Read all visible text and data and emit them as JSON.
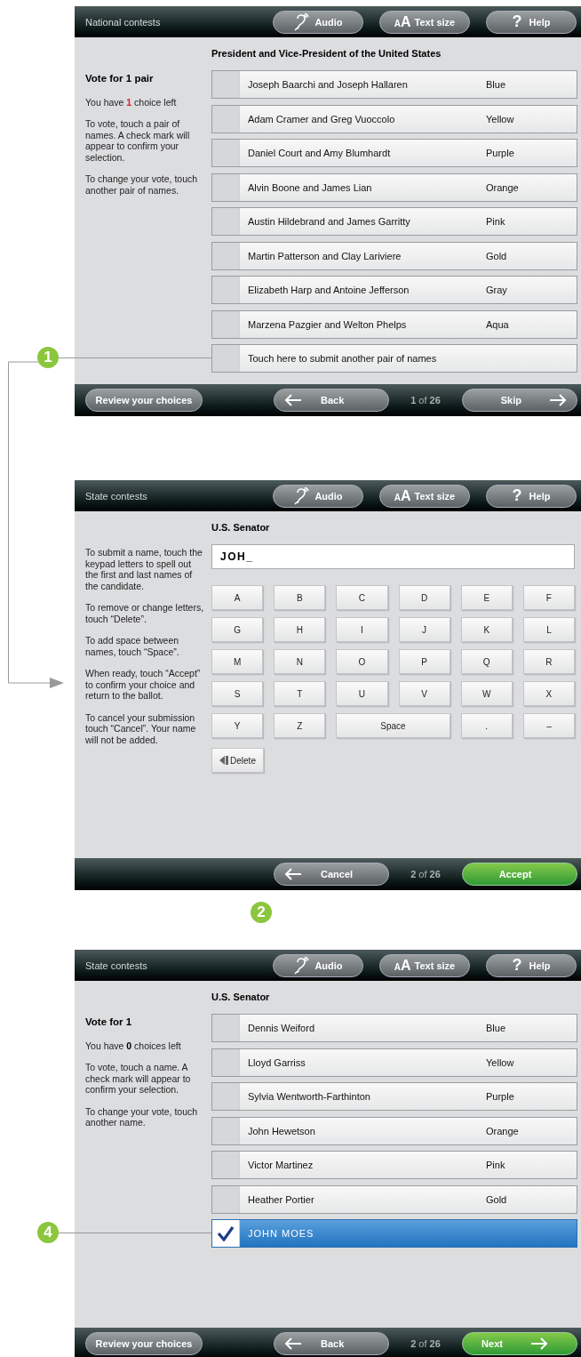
{
  "screens": [
    {
      "kind": "ballot",
      "header": {
        "section": "National contests",
        "buttons": [
          {
            "kind": "audio",
            "label": "Audio"
          },
          {
            "kind": "text-size",
            "glyph": "AA",
            "label": "Text size"
          },
          {
            "kind": "help",
            "glyph": "?",
            "label": "Help"
          }
        ]
      },
      "contest": "President and Vice-President of the United States",
      "sidebar": [
        {
          "kind": "heading",
          "text": "Vote for 1 pair"
        },
        {
          "kind": "count",
          "text": "You have **1** choice left",
          "highlight": true
        },
        {
          "kind": "text",
          "text": "To vote, touch a pair of names. A check mark will appear to confirm your selection."
        },
        {
          "kind": "text",
          "text": "To change your vote, touch another pair of names."
        }
      ],
      "rows": [
        {
          "name": "Joseph Baarchi and Joseph Hallaren",
          "party": "Blue",
          "selected": false
        },
        {
          "name": "Adam Cramer and Greg Vuoccolo",
          "party": "Yellow",
          "selected": false
        },
        {
          "name": "Daniel Court and Amy Blumhardt",
          "party": "Purple",
          "selected": false
        },
        {
          "name": "Alvin Boone and James Lian",
          "party": "Orange",
          "selected": false
        },
        {
          "name": "Austin Hildebrand and James Garritty",
          "party": "Pink",
          "selected": false
        },
        {
          "name": "Martin Patterson and Clay Lariviere",
          "party": "Gold",
          "selected": false
        },
        {
          "name": "Elizabeth Harp and Antoine Jefferson",
          "party": "Gray",
          "selected": false
        },
        {
          "name": "Marzena Pazgier and Welton Phelps",
          "party": "Aqua",
          "selected": false
        },
        {
          "name": "Touch here to submit another pair of names",
          "selected": false,
          "callout": "1"
        }
      ],
      "footer": {
        "review": {
          "label": "Review your choices"
        },
        "back": {
          "label": "Back"
        },
        "page": "**1** of **26**",
        "forward": {
          "label": "Skip",
          "arrow": true,
          "highlighted": false
        }
      }
    },
    {
      "kind": "keypad",
      "header": {
        "section": "State contests",
        "buttons": [
          {
            "kind": "audio",
            "label": "Audio"
          },
          {
            "kind": "text-size",
            "glyph": "AA",
            "label": "Text size"
          },
          {
            "kind": "help",
            "glyph": "?",
            "label": "Help"
          }
        ]
      },
      "contest": "U.S. Senator",
      "sidebar": [
        {
          "kind": "text",
          "text": "To submit a name, touch the keypad letters to spell out the first and last names of the candidate."
        },
        {
          "kind": "text",
          "text": "To remove or change letters, touch “Delete”."
        },
        {
          "kind": "text",
          "text": "To add space between names, touch “Space”."
        },
        {
          "kind": "text",
          "text": "When ready, touch “Accept” to confirm your choice and return to the ballot."
        },
        {
          "kind": "text",
          "text": "To cancel your submission touch “Cancel”. Your name will not be added."
        }
      ],
      "input": {
        "value": "JOH_"
      },
      "keys": [
        {
          "label": "A"
        },
        {
          "label": "B"
        },
        {
          "label": "C"
        },
        {
          "label": "D"
        },
        {
          "label": "E"
        },
        {
          "label": "F"
        },
        {
          "label": "G"
        },
        {
          "label": "H"
        },
        {
          "label": "I"
        },
        {
          "label": "J"
        },
        {
          "label": "K"
        },
        {
          "label": "L"
        },
        {
          "label": "M"
        },
        {
          "label": "N"
        },
        {
          "label": "O"
        },
        {
          "label": "P"
        },
        {
          "label": "Q"
        },
        {
          "label": "R"
        },
        {
          "label": "S"
        },
        {
          "label": "T"
        },
        {
          "label": "U"
        },
        {
          "label": "V"
        },
        {
          "label": "W"
        },
        {
          "label": "X"
        },
        {
          "label": "Y"
        },
        {
          "label": "Z"
        },
        {
          "label": "Space",
          "wide": true
        },
        {
          "label": "."
        },
        {
          "label": "–"
        }
      ],
      "delete": {
        "label": "Delete"
      },
      "footer": {
        "back": {
          "label": "Cancel"
        },
        "page": "**2** of **26**",
        "forward": {
          "label": "Accept",
          "arrow": false,
          "highlighted": true
        }
      },
      "callout": "2"
    },
    {
      "kind": "ballot",
      "header": {
        "section": "State contests",
        "buttons": [
          {
            "kind": "audio",
            "label": "Audio"
          },
          {
            "kind": "text-size",
            "glyph": "AA",
            "label": "Text size"
          },
          {
            "kind": "help",
            "glyph": "?",
            "label": "Help"
          }
        ]
      },
      "contest": "U.S. Senator",
      "sidebar": [
        {
          "kind": "heading",
          "text": "Vote for 1"
        },
        {
          "kind": "count",
          "text": "You have **0** choices left",
          "highlight": false
        },
        {
          "kind": "text",
          "text": "To vote, touch a name. A check mark will appear to confirm your selection."
        },
        {
          "kind": "text",
          "text": "To change your vote, touch another name."
        }
      ],
      "rows": [
        {
          "name": "Dennis Weiford",
          "party": "Blue",
          "selected": false
        },
        {
          "name": "Lloyd Garriss",
          "party": "Yellow",
          "selected": false
        },
        {
          "name": "Sylvia Wentworth-Farthinton",
          "party": "Purple",
          "selected": false
        },
        {
          "name": "John Hewetson",
          "party": "Orange",
          "selected": false
        },
        {
          "name": "Victor Martinez",
          "party": "Pink",
          "selected": false
        },
        {
          "name": "Heather Portier",
          "party": "Gold",
          "selected": false
        },
        {
          "name": "JOHN MOES",
          "selected": true,
          "callout": "4"
        }
      ],
      "footer": {
        "review": {
          "label": "Review your choices"
        },
        "back": {
          "label": "Back"
        },
        "page": "**2** of **26**",
        "forward": {
          "label": "Next",
          "arrow": true,
          "highlighted": true
        }
      }
    }
  ]
}
